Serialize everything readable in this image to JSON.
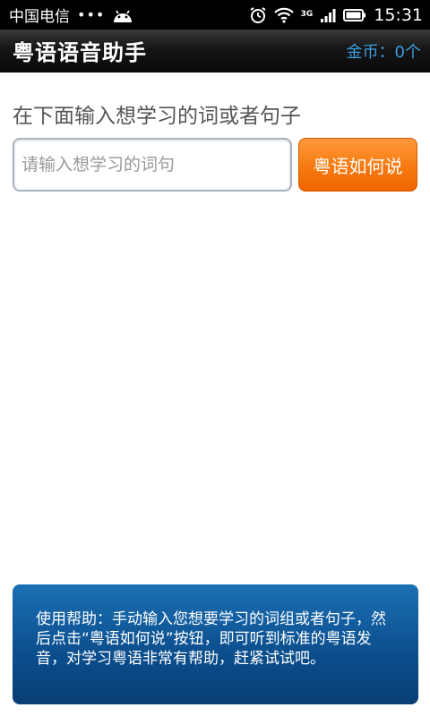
{
  "statusbar": {
    "carrier": "中国电信",
    "dots": "•••",
    "network": "3G",
    "time": "15:31"
  },
  "appbar": {
    "title": "粤语语音助手",
    "coins": "金币：0个"
  },
  "main": {
    "prompt": "在下面输入想学习的词或者句子",
    "input_placeholder": "请输入想学习的词句",
    "button_label": "粤语如何说"
  },
  "help": {
    "text": "使用帮助：手动输入您想要学习的词组或者句子，然后点击“粤语如何说”按钮，即可听到标准的粤语发音，对学习粤语非常有帮助，赶紧试试吧。"
  },
  "colors": {
    "accent_orange": "#f77a10",
    "coin_blue": "#3aa0e0",
    "help_blue": "#0b4d8c"
  }
}
